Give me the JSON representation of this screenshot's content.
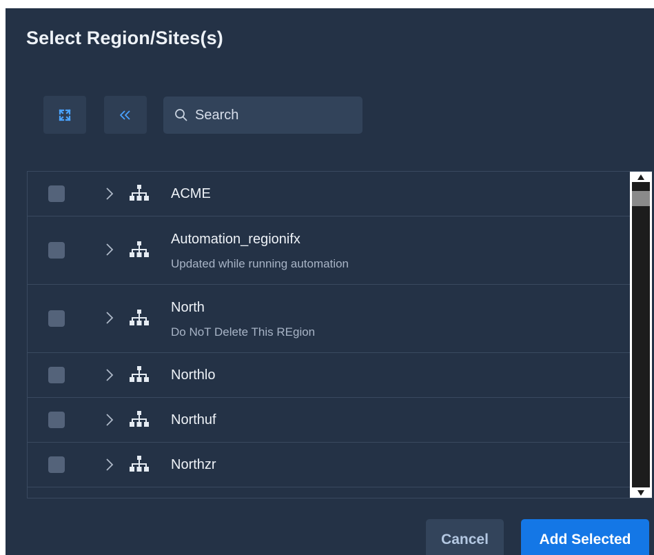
{
  "dialog": {
    "title": "Select Region/Sites(s)"
  },
  "toolbar": {
    "expand_icon": "expand-arrows-icon",
    "collapse_icon": "double-chevron-left-icon",
    "search_placeholder": "Search",
    "search_value": ""
  },
  "list": {
    "items": [
      {
        "name": "ACME",
        "description": "",
        "checked": false
      },
      {
        "name": "Automation_regionifx",
        "description": "Updated while running automation",
        "checked": false
      },
      {
        "name": "North",
        "description": "Do NoT Delete This REgion",
        "checked": false
      },
      {
        "name": "Northlo",
        "description": "",
        "checked": false
      },
      {
        "name": "Northuf",
        "description": "",
        "checked": false
      },
      {
        "name": "Northzr",
        "description": "",
        "checked": false
      }
    ]
  },
  "footer": {
    "cancel_label": "Cancel",
    "add_label": "Add Selected"
  },
  "colors": {
    "background": "#243246",
    "accent": "#1477e6",
    "text": "#eef2f7",
    "muted_text": "#a8b4c6"
  }
}
